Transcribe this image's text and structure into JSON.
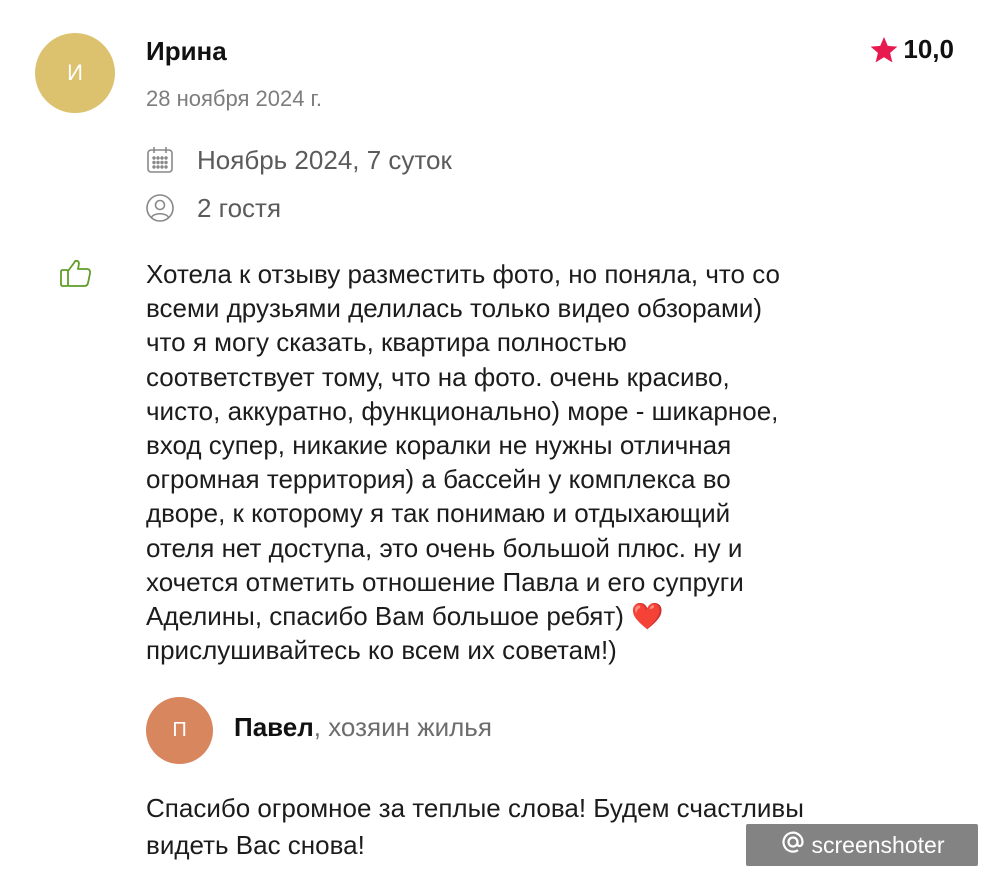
{
  "review": {
    "avatar_initial": "И",
    "avatar_color": "#dcc16f",
    "author": "Ирина",
    "date": "28 ноября 2024 г.",
    "rating": "10,0",
    "rating_icon": "star-icon",
    "star_color": "#e8194f",
    "stay": "Ноябрь 2024, 7 суток",
    "stay_icon": "calendar-icon",
    "guests": "2 гостя",
    "guests_icon": "person-icon",
    "sentiment_icon": "thumbs-up-icon",
    "text_lines": [
      "Хотела к отзыву разместить фото, но поняла, что со",
      "всеми друзьями делилась только видео обзорами)",
      "что я могу сказать, квартира полностью",
      "соответствует тому, что на фото. очень красиво,",
      "чисто, аккуратно, функционально) море - шикарное,",
      "вход супер, никакие коралки не нужны отличная",
      "огромная территория) а бассейн у комплекса во",
      "дворе, к которому я так понимаю и отдыхающий",
      "отеля нет доступа, это очень большой плюс. ну и",
      "хочется отметить отношение Павла и его супруги",
      "Аделины, спасибо Вам большое ребят) ❤️",
      "прислушивайтесь ко всем их советам!)"
    ]
  },
  "host_reply": {
    "avatar_initial": "П",
    "avatar_color": "#d8865d",
    "name": "Павел",
    "role": ", хозяин жилья",
    "text_lines": [
      "Спасибо огромное за теплые слова! Будем счастливы",
      "видеть Вас снова!"
    ]
  },
  "watermark": {
    "text": "screenshoter",
    "icon": "at-sign-icon"
  }
}
